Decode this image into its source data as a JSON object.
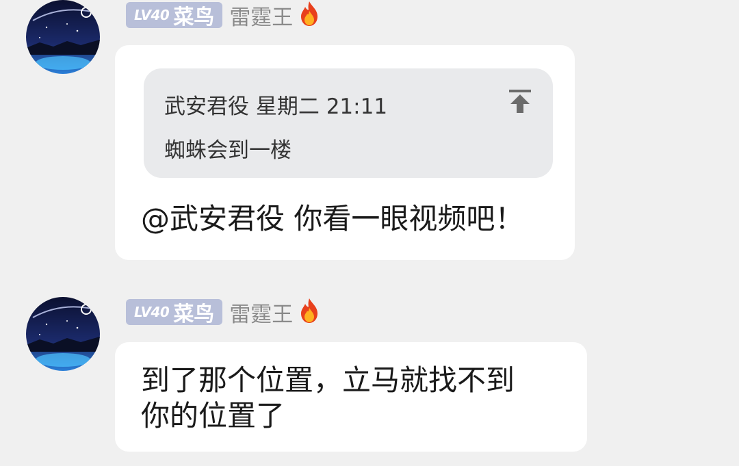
{
  "messages": [
    {
      "badge": {
        "level": "LV40",
        "rank": "菜鸟"
      },
      "username": "雷霆王",
      "icon": "fire-icon",
      "quote": {
        "author_time": "武安君役 星期二 21:11",
        "text": "蜘蛛会到一楼",
        "icon": "pin-top-icon"
      },
      "text": "@武安君役 你看一眼视频吧！"
    },
    {
      "badge": {
        "level": "LV40",
        "rank": "菜鸟"
      },
      "username": "雷霆王",
      "icon": "fire-icon",
      "text_lines": [
        "到了那个位置，立马就找不到",
        "你的位置了"
      ]
    }
  ],
  "colors": {
    "background": "#f0f0f0",
    "bubble": "#ffffff",
    "quote": "#e9eaec",
    "badge": "#b8bfd9",
    "username": "#8a8a8a"
  }
}
